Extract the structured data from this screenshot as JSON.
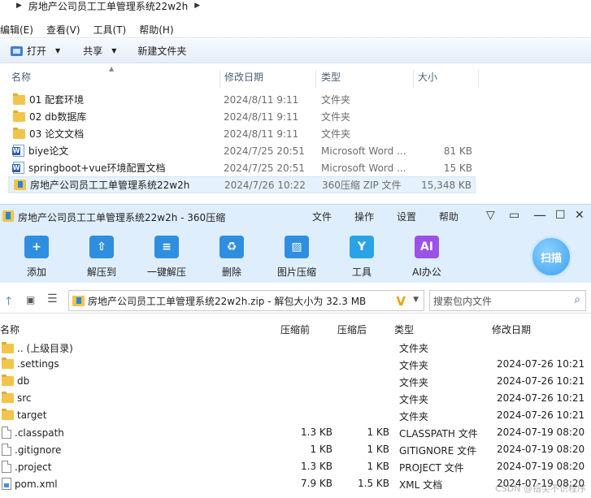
{
  "explorer": {
    "breadcrumb": "房地产公司员工工单管理系统22w2h",
    "menu": [
      "编辑(E)",
      "查看(V)",
      "工具(T)",
      "帮助(H)"
    ],
    "toolbar": {
      "open": "打开",
      "share": "共享",
      "new_folder": "新建文件夹"
    },
    "columns": {
      "name": "名称",
      "date": "修改日期",
      "type": "类型",
      "size": "大小"
    },
    "rows": [
      {
        "icon": "folder-icon",
        "name": "01 配套环境",
        "date": "2024/8/11 9:11",
        "type": "文件夹",
        "size": ""
      },
      {
        "icon": "folder-icon",
        "name": "02 db数据库",
        "date": "2024/8/11 9:11",
        "type": "文件夹",
        "size": ""
      },
      {
        "icon": "folder-icon",
        "name": "03 论文文档",
        "date": "2024/8/11 9:11",
        "type": "文件夹",
        "size": ""
      },
      {
        "icon": "word-doc-icon",
        "name": "biye论文",
        "date": "2024/7/25 20:51",
        "type": "Microsoft Word ...",
        "size": "81 KB"
      },
      {
        "icon": "word-doc-icon",
        "name": "springboot+vue环境配置文档",
        "date": "2024/7/25 20:51",
        "type": "Microsoft Word ...",
        "size": "15 KB"
      },
      {
        "icon": "zip-archive-icon",
        "name": "房地产公司员工工单管理系统22w2h",
        "date": "2024/7/26 10:22",
        "type": "360压缩 ZIP 文件",
        "size": "15,348 KB"
      }
    ]
  },
  "zip": {
    "title": "房地产公司员工工单管理系统22w2h - 360压缩",
    "menu": [
      "文件",
      "操作",
      "设置",
      "帮助"
    ],
    "window_controls": [
      "▽",
      "▭",
      "☐",
      "✕"
    ],
    "tools": [
      {
        "label": "添加",
        "icon": "add-icon",
        "color": "#2f8ee0"
      },
      {
        "label": "解压到",
        "icon": "extract-to-icon",
        "color": "#2f8ee0"
      },
      {
        "label": "一键解压",
        "icon": "one-click-extract-icon",
        "color": "#2f8ee0"
      },
      {
        "label": "删除",
        "icon": "delete-icon",
        "color": "#2f8ee0"
      },
      {
        "label": "图片压缩",
        "icon": "image-compress-icon",
        "color": "#2f8ee0"
      },
      {
        "label": "工具",
        "icon": "tools-icon",
        "color": "#2aa3e6"
      },
      {
        "label": "AI办公",
        "icon": "ai-office-icon",
        "color": "#9b52e6"
      }
    ],
    "ai_glyph": "AI",
    "scan_label": "扫描",
    "path": "房地产公司员工工单管理系统22w2h.zip - 解包大小为 32.3 MB",
    "search_placeholder": "搜索包内文件",
    "columns": {
      "name": "名称",
      "compressed": "压缩前",
      "original": "压缩后",
      "type": "类型",
      "date": "修改日期"
    },
    "rows": [
      {
        "icon": "folder-icon",
        "name": ".. (上级目录)",
        "before": "",
        "after": "",
        "type": "文件夹",
        "date": ""
      },
      {
        "icon": "folder-icon",
        "name": ".settings",
        "before": "",
        "after": "",
        "type": "文件夹",
        "date": "2024-07-26 10:21"
      },
      {
        "icon": "folder-icon",
        "name": "db",
        "before": "",
        "after": "",
        "type": "文件夹",
        "date": "2024-07-26 10:21"
      },
      {
        "icon": "folder-icon",
        "name": "src",
        "before": "",
        "after": "",
        "type": "文件夹",
        "date": "2024-07-26 10:21"
      },
      {
        "icon": "folder-icon",
        "name": "target",
        "before": "",
        "after": "",
        "type": "文件夹",
        "date": "2024-07-26 10:21"
      },
      {
        "icon": "file-icon",
        "name": ".classpath",
        "before": "1.3 KB",
        "after": "1 KB",
        "type": "CLASSPATH 文件",
        "date": "2024-07-19 08:20"
      },
      {
        "icon": "file-icon",
        "name": ".gitignore",
        "before": "1 KB",
        "after": "1 KB",
        "type": "GITIGNORE 文件",
        "date": "2024-07-19 08:20"
      },
      {
        "icon": "file-icon",
        "name": ".project",
        "before": "1.3 KB",
        "after": "1 KB",
        "type": "PROJECT 文件",
        "date": "2024-07-19 08:20"
      },
      {
        "icon": "xml-file-icon",
        "name": "pom.xml",
        "before": "7.9 KB",
        "after": "1.5 KB",
        "type": "XML 文档",
        "date": "2024-07-19 08:20"
      }
    ],
    "watermark": "CSDN @指尖不识程序"
  }
}
